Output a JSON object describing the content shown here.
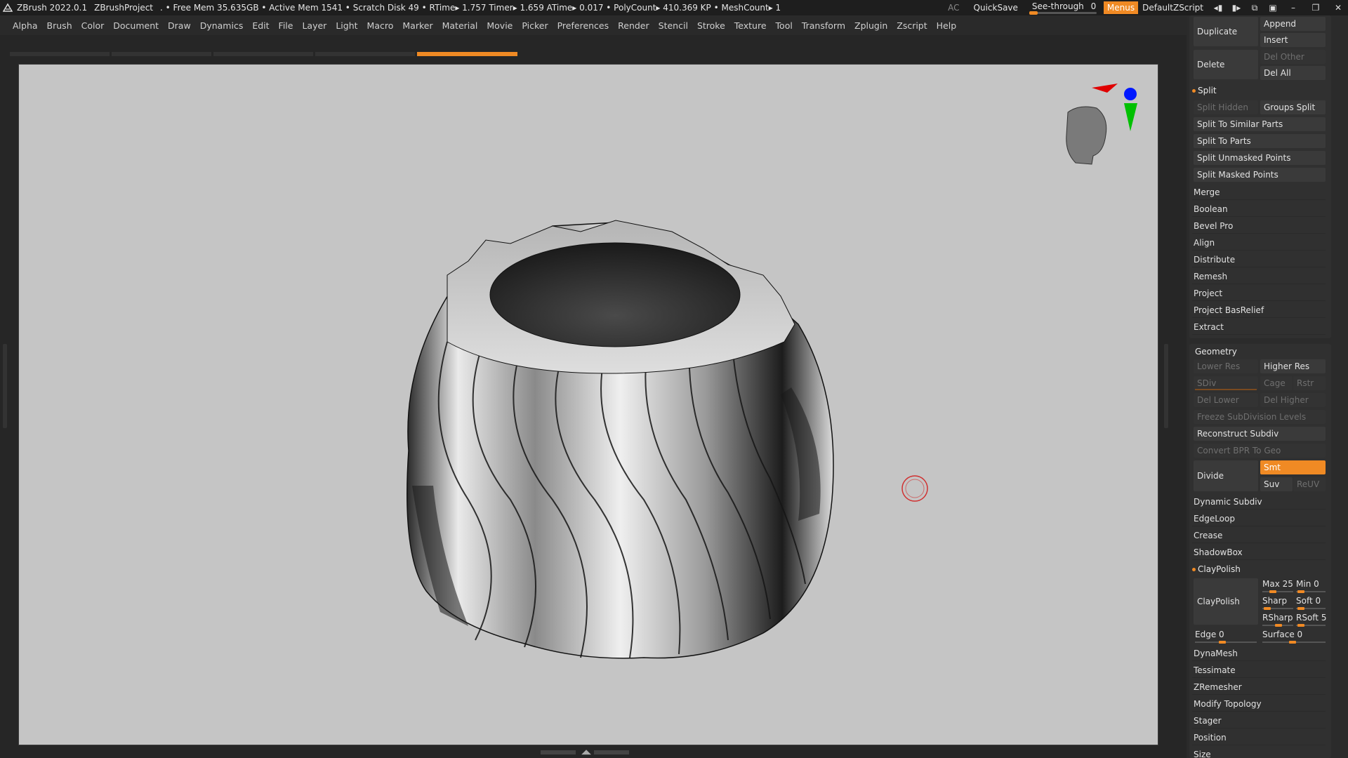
{
  "titlebar": {
    "app": "ZBrush 2022.0.1",
    "project": "ZBrushProject",
    "stats": ". • Free Mem 35.635GB • Active Mem 1541 • Scratch Disk 49 •  RTime▸ 1.757 Timer▸ 1.659 ATime▸ 0.017 • PolyCount▸ 410.369 KP  • MeshCount▸ 1",
    "ac": "AC",
    "quicksave": "QuickSave",
    "see_through_label": "See-through",
    "see_through_value": "0",
    "menus": "Menus",
    "script": "DefaultZScript"
  },
  "menubar": [
    "Alpha",
    "Brush",
    "Color",
    "Document",
    "Draw",
    "Dynamics",
    "Edit",
    "File",
    "Layer",
    "Light",
    "Macro",
    "Marker",
    "Material",
    "Movie",
    "Picker",
    "Preferences",
    "Render",
    "Stencil",
    "Stroke",
    "Texture",
    "Tool",
    "Transform",
    "Zplugin",
    "Zscript",
    "Help"
  ],
  "subtool": {
    "duplicate": "Duplicate",
    "append": "Append",
    "insert": "Insert",
    "delete": "Delete",
    "del_other": "Del Other",
    "del_all": "Del All",
    "split_header": "Split",
    "split_hidden": "Split Hidden",
    "groups_split": "Groups Split",
    "split_similar": "Split To Similar Parts",
    "split_parts": "Split To Parts",
    "split_unmasked": "Split Unmasked Points",
    "split_masked": "Split Masked Points",
    "items": [
      "Merge",
      "Boolean",
      "Bevel Pro",
      "Align",
      "Distribute",
      "Remesh",
      "Project",
      "Project BasRelief",
      "Extract"
    ]
  },
  "geometry": {
    "header": "Geometry",
    "lower_res": "Lower Res",
    "higher_res": "Higher Res",
    "sdiv": "SDiv",
    "cage": "Cage",
    "rstr": "Rstr",
    "del_lower": "Del Lower",
    "del_higher": "Del Higher",
    "freeze": "Freeze SubDivision Levels",
    "reconstruct": "Reconstruct Subdiv",
    "convert_bpr": "Convert BPR To Geo",
    "divide": "Divide",
    "smt": "Smt",
    "suv": "Suv",
    "reuv": "ReUV",
    "items1": [
      "Dynamic Subdiv",
      "EdgeLoop",
      "Crease",
      "ShadowBox"
    ],
    "claypolish_header": "ClayPolish",
    "claypolish_btn": "ClayPolish",
    "max": "Max 25",
    "min": "Min 0",
    "sharp": "Sharp",
    "soft": "Soft 0",
    "rsharp": "RSharp",
    "rsoft": "RSoft 5",
    "edge": "Edge 0",
    "surface": "Surface 0",
    "items2": [
      "DynaMesh",
      "Tessimate",
      "ZRemesher",
      "Modify Topology",
      "Stager",
      "Position",
      "Size"
    ]
  },
  "colors": {
    "accent": "#f08a24",
    "canvas": "#c5c5c5",
    "panel": "#2b2b2b"
  }
}
